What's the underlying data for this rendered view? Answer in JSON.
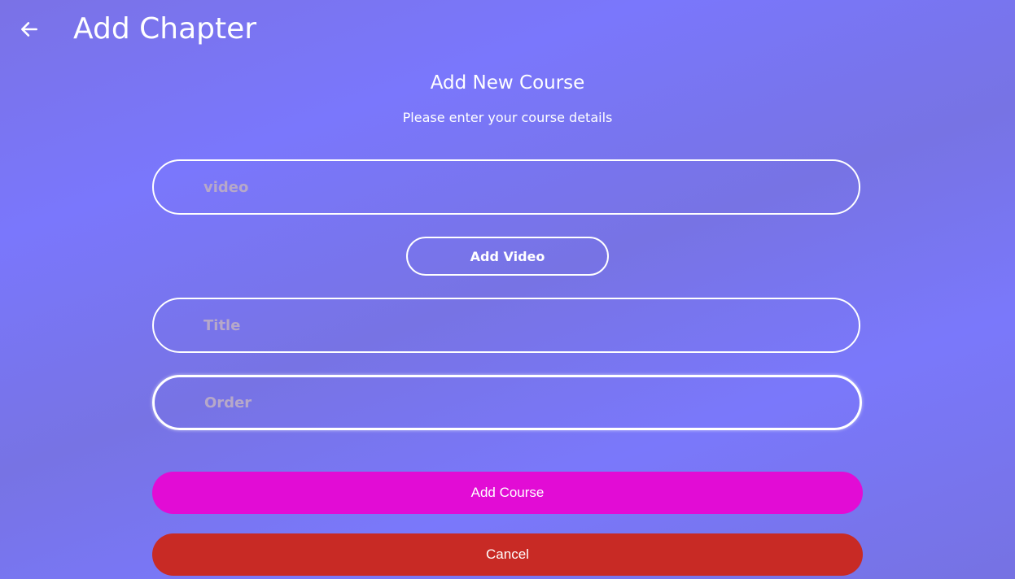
{
  "header": {
    "title": "Add Chapter",
    "back_icon": "arrow-left-icon"
  },
  "form": {
    "title": "Add New Course",
    "subtitle": "Please enter your course details",
    "video_field": {
      "value": "",
      "placeholder": "video"
    },
    "add_video_label": "Add Video",
    "title_field": {
      "value": "",
      "placeholder": "Title"
    },
    "order_field": {
      "value": "",
      "placeholder": "Order"
    },
    "submit_label": "Add Course",
    "cancel_label": "Cancel"
  },
  "colors": {
    "background": "#7a77f2",
    "text": "#ffffff",
    "placeholder": "#b6a8c9",
    "submit": "#e20cd5",
    "cancel": "#c82a25"
  }
}
